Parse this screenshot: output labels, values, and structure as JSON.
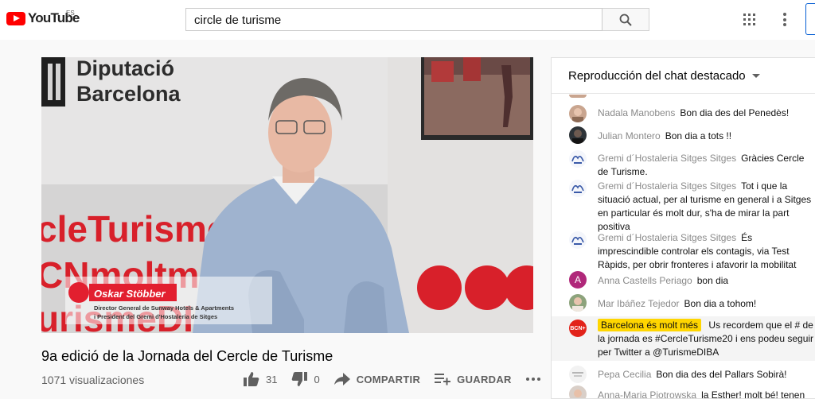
{
  "header": {
    "logo_text": "YouTube",
    "region_code": "ES",
    "search_value": "circle de turisme",
    "search_icon": "search-icon",
    "apps_icon": "apps-grid-icon",
    "menu_icon": "more-vert-icon"
  },
  "video": {
    "overlay": {
      "brand_line1": "Diputació",
      "brand_line2": "Barcelona",
      "banner_line1": "cleTurisme",
      "banner_line2": "CNmoltme",
      "banner_line3": "urismeDIB",
      "lower_third_name": "Oskar Stöbber",
      "lower_third_role1": "Director General de Sunway Hotels & Apartments",
      "lower_third_role2": "i President del Gremi d'Hostaleria de Sitges"
    },
    "title": "9a edició de la Jornada del Cercle de Turisme",
    "views": "1071 visualizaciones",
    "likes": "31",
    "dislikes": "0",
    "share_label": "COMPARTIR",
    "save_label": "GUARDAR"
  },
  "chat": {
    "header": "Reproducción del chat destacado",
    "messages": [
      {
        "author": "Nadala Manobens",
        "text": "Bon dia des del Penedès!",
        "avatar": "photo"
      },
      {
        "author": "Julian Montero",
        "text": "Bon dia a tots !!",
        "avatar": "photo-dark"
      },
      {
        "author": "Gremi d´Hostaleria Sitges Sitges",
        "text": "Gràcies Cercle de Turisme.",
        "avatar": "logo"
      },
      {
        "author": "Gremi d´Hostaleria Sitges Sitges",
        "text": "Tot i que la situació actual, per al turisme en general i a Sitges en particular és molt dur, s'ha de mirar la part positiva",
        "avatar": "logo"
      },
      {
        "author": "Gremi d´Hostaleria Sitges Sitges",
        "text": "És imprescindible controlar els contagis, via Test Ràpids, per obrir fronteres i afavorir la mobilitat",
        "avatar": "logo"
      },
      {
        "author": "Anna Castells Periago",
        "text": "bon dia",
        "avatar": "letter",
        "letter": "A"
      },
      {
        "author": "Mar Ibáñez Tejedor",
        "text": "Bon dia a tohom!",
        "avatar": "photo"
      },
      {
        "author": "Barcelona és molt més",
        "text": "Us recordem que el # de la jornada es #CercleTurisme20 i ens podeu seguir per Twitter a @TurismeDIBA",
        "avatar": "bcn",
        "avatar_text": "BCN+"
      },
      {
        "author": "Pepa Cecilia",
        "text": "Bon dia des del Pallars Sobirà!",
        "avatar": "logo-light"
      },
      {
        "author": "Anna-Maria Piotrowska",
        "text": "la Esther! molt bé! tenen",
        "avatar": "photo"
      }
    ]
  },
  "colors": {
    "brand_red": "#ff0000",
    "accent_blue": "#065fd4",
    "highlight_chip": "#ffd600",
    "banner_red": "#d8202a"
  }
}
